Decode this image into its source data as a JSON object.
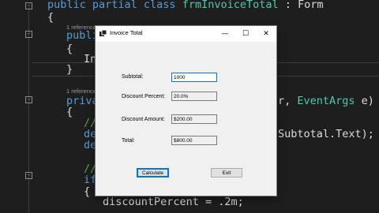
{
  "code": {
    "line1_keywords": "public partial class",
    "line1_type": "frmInvoiceTotal",
    "line1_rest": " : Form",
    "line2": "{",
    "ref1": "1 reference",
    "line3_partial": "public",
    "line4": "{",
    "line5_partial": "In",
    "line6": "}",
    "ref2": "1 reference",
    "line7_partial": "private",
    "line7_right_punct": "r, ",
    "line7_right_type": "EventArgs",
    "line7_right_rest": " e)",
    "line8": "{",
    "line9_partial": "//",
    "line10_partial": "de",
    "line10_right": "Subtotal.Text);",
    "line11_partial": "de",
    "line12_partial": "//",
    "line13_partial": "if",
    "line14": "{",
    "line15": "discountPercent = .2m;",
    "collapse_symbol": "−"
  },
  "window": {
    "title": "Invoice Total",
    "minimize": "—",
    "maximize": "☐",
    "close": "✕",
    "subtotal_label": "Subtotal:",
    "subtotal_value": "1000",
    "discount_percent_label": "Discount Percent:",
    "discount_percent_value": "20.0%",
    "discount_amount_label": "Discount Amount:",
    "discount_amount_value": "$200.00",
    "total_label": "Total:",
    "total_value": "$800.00",
    "calculate_button": "Calculate",
    "exit_button": "Exit"
  }
}
